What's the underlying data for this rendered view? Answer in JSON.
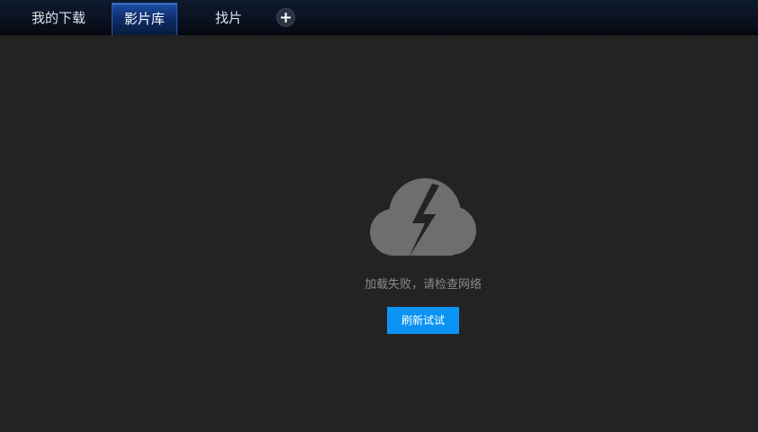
{
  "tabs": [
    {
      "label": "我的下载",
      "active": false
    },
    {
      "label": "影片库",
      "active": true
    },
    {
      "label": "找片",
      "active": false
    }
  ],
  "add_tab_icon": "plus-icon",
  "error": {
    "icon": "cloud-lightning-icon",
    "message": "加载失败，请检查网络",
    "retry_label": "刷新试试"
  },
  "colors": {
    "background": "#232323",
    "topbar": "#0a1222",
    "active_tab": "#1d4fa8",
    "retry_button": "#0a93f5",
    "message_text": "#8a8a8a",
    "icon_gray": "#6e6e6e"
  }
}
